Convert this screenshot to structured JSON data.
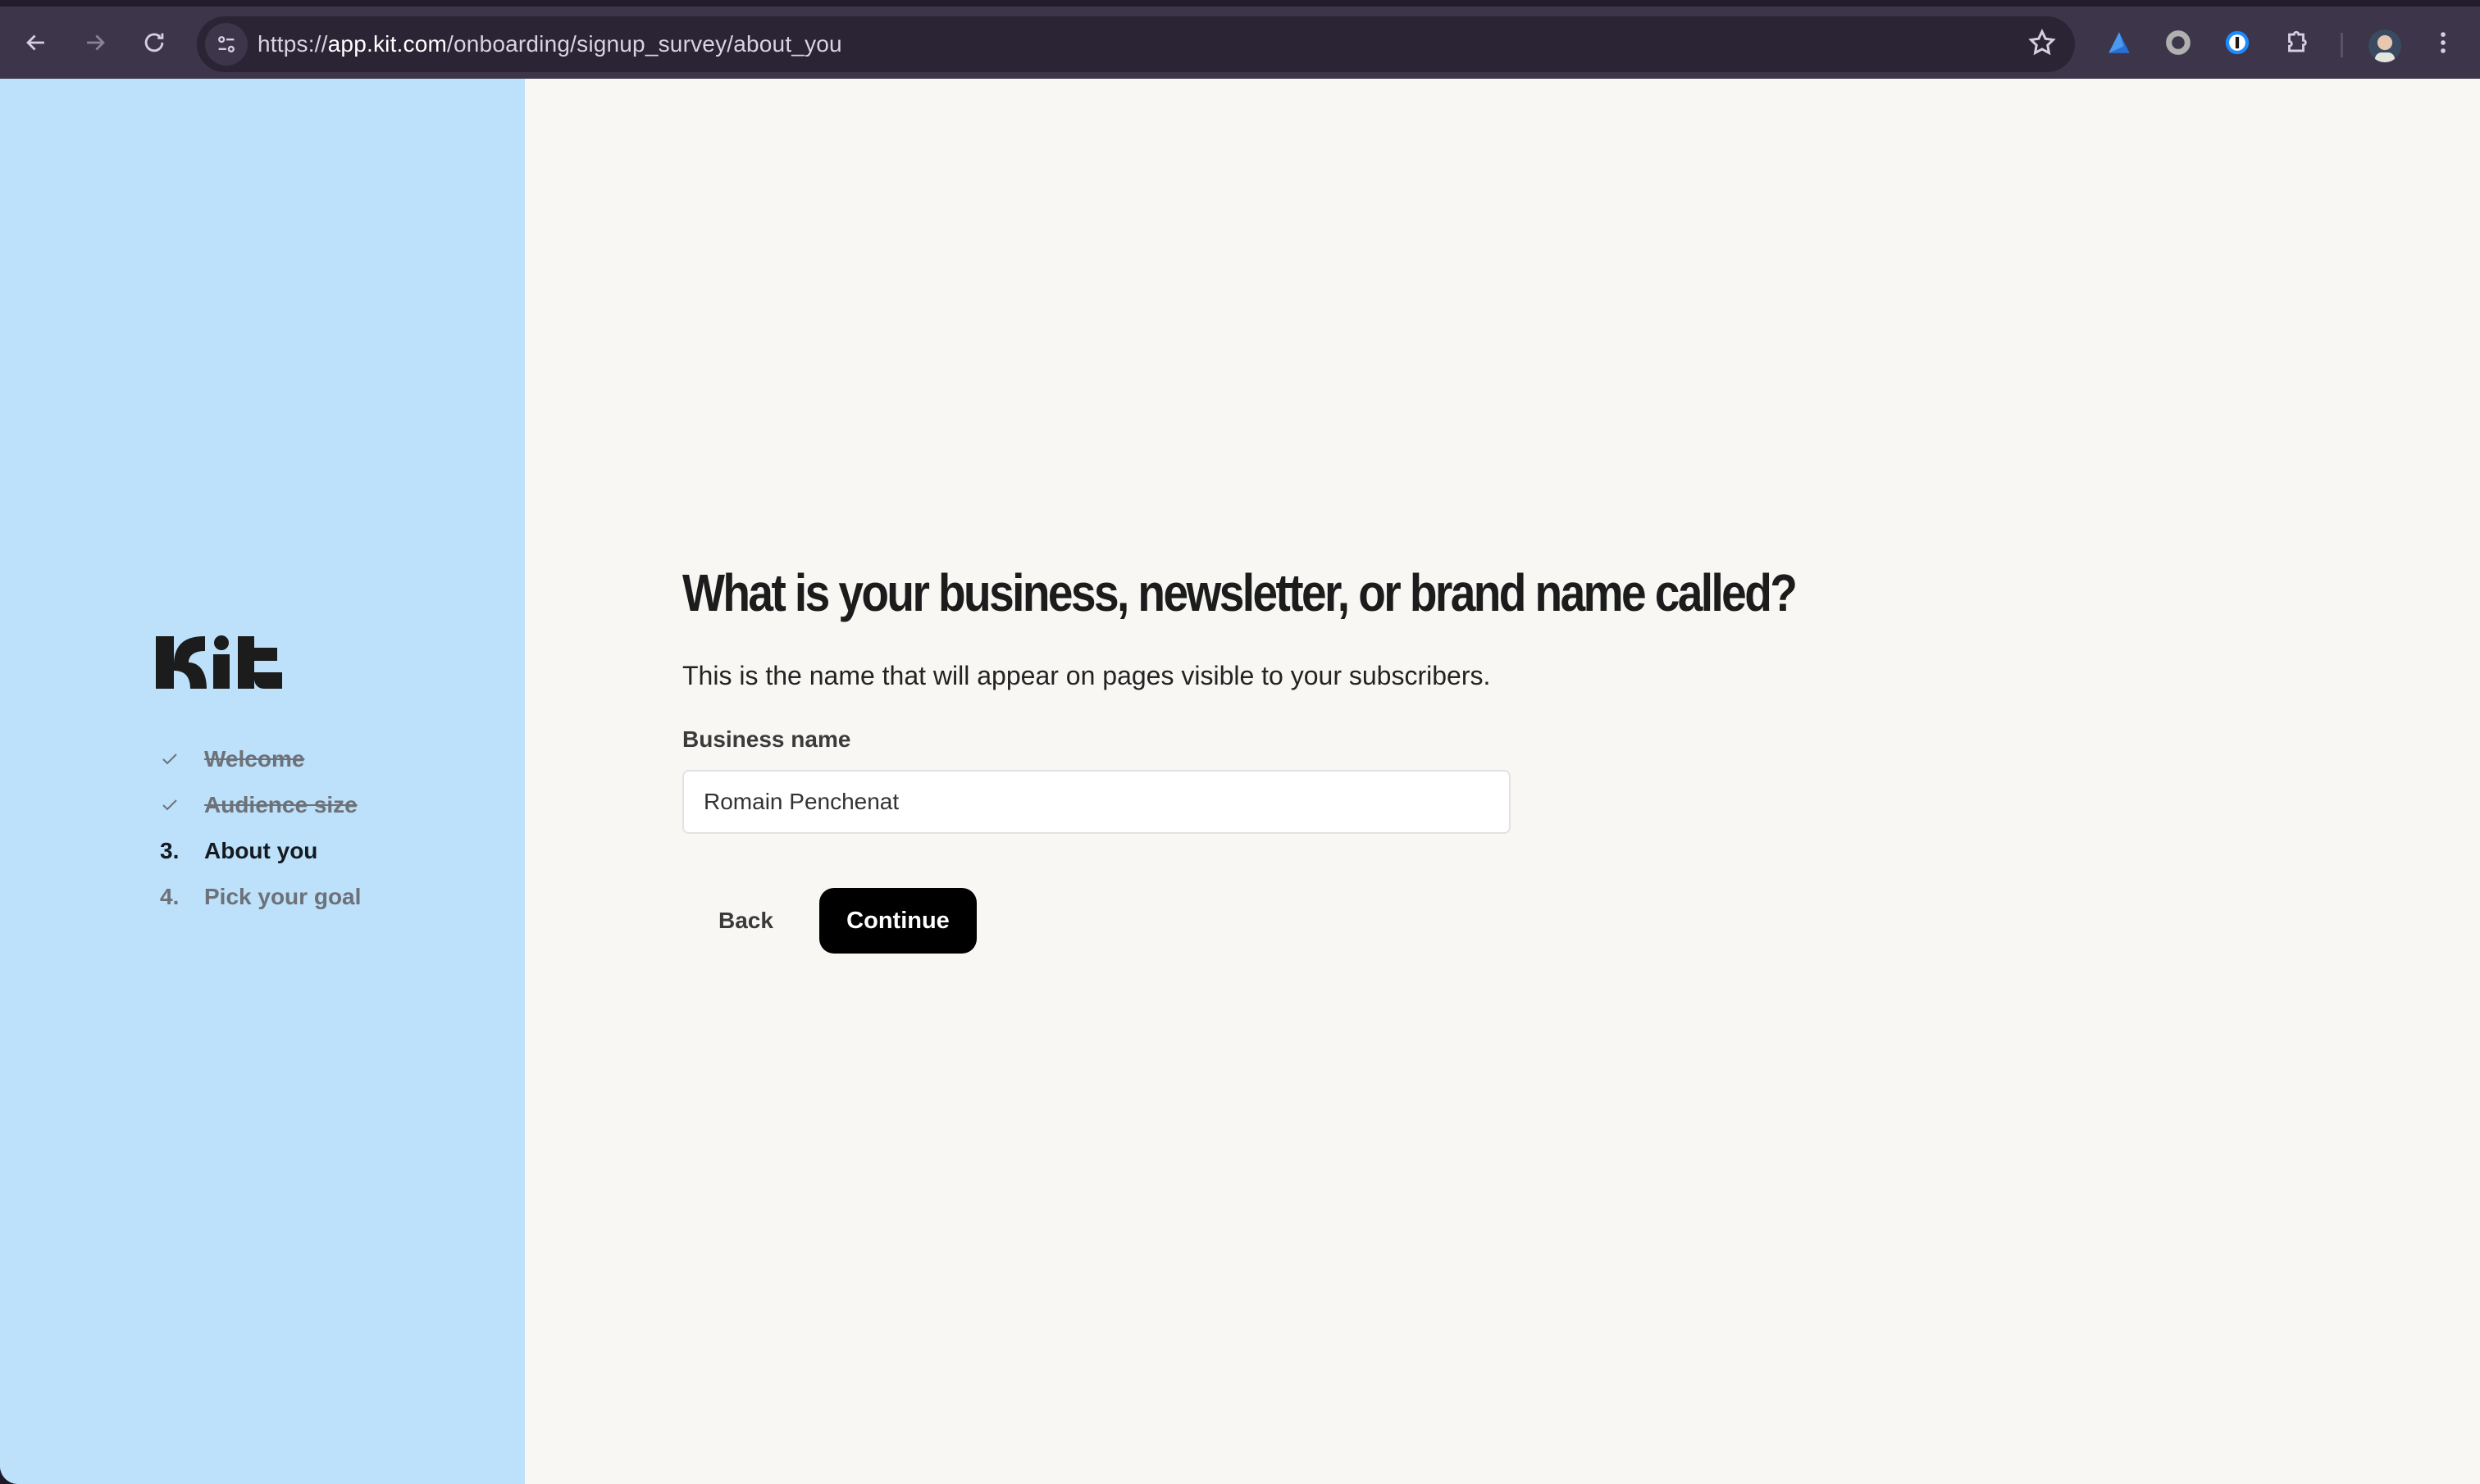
{
  "browser": {
    "url_scheme": "https://",
    "url_host": "app.kit.com",
    "url_path": "/onboarding/signup_survey/about_you",
    "extensions": [
      "triangle-extension-icon",
      "record-extension-icon",
      "password-manager-extension-icon",
      "extensions-puzzle-icon"
    ]
  },
  "sidebar": {
    "logo": "Kit",
    "steps": [
      {
        "marker": "✓",
        "label": "Welcome",
        "status": "done"
      },
      {
        "marker": "✓",
        "label": "Audience size",
        "status": "done"
      },
      {
        "marker": "3.",
        "label": "About you",
        "status": "current"
      },
      {
        "marker": "4.",
        "label": "Pick your goal",
        "status": "todo"
      }
    ]
  },
  "main": {
    "title": "What is your business, newsletter, or brand name called?",
    "subtitle": "This is the name that will appear on pages visible to your subscribers.",
    "field_label": "Business name",
    "field_value": "Romain Penchenat",
    "back_label": "Back",
    "continue_label": "Continue"
  },
  "colors": {
    "sidebar_bg": "#bde1fa",
    "main_bg": "#f8f7f4",
    "primary_button": "#000000",
    "browser_chrome": "#3d3549"
  }
}
